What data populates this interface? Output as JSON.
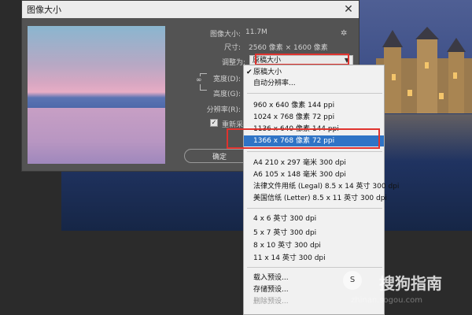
{
  "dialog": {
    "title": "图像大小",
    "image_size_label": "图像大小:",
    "image_size_value": "11.7M",
    "dimensions_label": "尺寸:",
    "dimensions_value": "2560 像素 × 1600 像素",
    "fit_label": "调整为:",
    "fit_value": "原稿大小",
    "width_label": "宽度(D):",
    "height_label": "高度(G):",
    "resolution_label": "分辨率(R):",
    "resample_label": "重新采样(S):",
    "ok_label": "确定"
  },
  "dropdown": {
    "items": [
      {
        "label": "原稿大小",
        "checked": true
      },
      {
        "label": "自动分辨率..."
      },
      {
        "label": "960 x 640 像素 144 ppi"
      },
      {
        "label": "1024 x 768 像素 72 ppi"
      },
      {
        "label": "1136 x 640 像素 144 ppi"
      },
      {
        "label": "1366 x 768 像素 72 ppi",
        "selected": true
      },
      {
        "label": "A4 210 x 297 毫米 300 dpi"
      },
      {
        "label": "A6 105 x 148 毫米 300 dpi"
      },
      {
        "label": "法律文件用纸 (Legal) 8.5 x 14 英寸 300 dpi"
      },
      {
        "label": "美国信纸 (Letter) 8.5 x 11 英寸 300 dpi"
      },
      {
        "label": "4 x 6 英寸 300 dpi"
      },
      {
        "label": "5 x 7 英寸 300 dpi"
      },
      {
        "label": "8 x 10 英寸 300 dpi"
      },
      {
        "label": "11 x 14 英寸 300 dpi"
      },
      {
        "label": "载入预设..."
      },
      {
        "label": "存储预设..."
      },
      {
        "label": "删除预设...",
        "disabled": true
      }
    ]
  },
  "watermark": {
    "text": "搜狗指南",
    "url": "zhinan.sogou.com"
  },
  "colors": {
    "accent": "#2f74c6",
    "highlight_box": "#e0332e",
    "dialog_bg": "#535353"
  },
  "icons": {
    "close": "close-icon",
    "gear": "gear-icon",
    "chain": "link-icon",
    "check": "check-icon"
  }
}
